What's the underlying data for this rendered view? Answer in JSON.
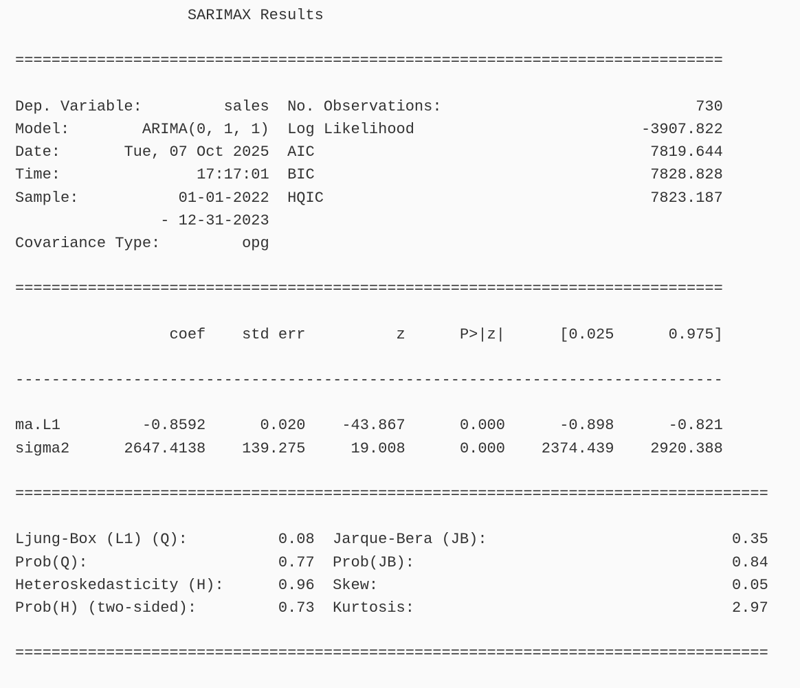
{
  "report": {
    "title": "SARIMAX Results",
    "model_info": {
      "rows": [
        {
          "left_label": "Dep. Variable:",
          "left_value": "sales",
          "right_label": "No. Observations:",
          "right_value": "730"
        },
        {
          "left_label": "Model:",
          "left_value": "ARIMA(0, 1, 1)",
          "right_label": "Log Likelihood",
          "right_value": "-3907.822"
        },
        {
          "left_label": "Date:",
          "left_value": "Tue, 07 Oct 2025",
          "right_label": "AIC",
          "right_value": "7819.644"
        },
        {
          "left_label": "Time:",
          "left_value": "17:17:01",
          "right_label": "BIC",
          "right_value": "7828.828"
        },
        {
          "left_label": "Sample:",
          "left_value": "01-01-2022",
          "right_label": "HQIC",
          "right_value": "7823.187"
        },
        {
          "left_label": "",
          "left_value": "- 12-31-2023",
          "right_label": "",
          "right_value": ""
        },
        {
          "left_label": "Covariance Type:",
          "left_value": "opg",
          "right_label": "",
          "right_value": ""
        }
      ]
    },
    "coef_table": {
      "headers": [
        "",
        "coef",
        "std err",
        "z",
        "P>|z|",
        "[0.025",
        "0.975]"
      ],
      "rows": [
        [
          "ma.L1",
          "-0.8592",
          "0.020",
          "-43.867",
          "0.000",
          "-0.898",
          "-0.821"
        ],
        [
          "sigma2",
          "2647.4138",
          "139.275",
          "19.008",
          "0.000",
          "2374.439",
          "2920.388"
        ]
      ]
    },
    "diagnostics": {
      "rows": [
        {
          "left_label": "Ljung-Box (L1) (Q):",
          "left_value": "0.08",
          "right_label": "Jarque-Bera (JB):",
          "right_value": "0.35"
        },
        {
          "left_label": "Prob(Q):",
          "left_value": "0.77",
          "right_label": "Prob(JB):",
          "right_value": "0.84"
        },
        {
          "left_label": "Heteroskedasticity (H):",
          "left_value": "0.96",
          "right_label": "Skew:",
          "right_value": "0.05"
        },
        {
          "left_label": "Prob(H) (two-sided):",
          "left_value": "0.73",
          "right_label": "Kurtosis:",
          "right_value": "2.97"
        }
      ]
    },
    "separators": {
      "double_short": "==============================================================================",
      "single_short": "------------------------------------------------------------------------------",
      "double_long": "==================================================================================="
    }
  }
}
